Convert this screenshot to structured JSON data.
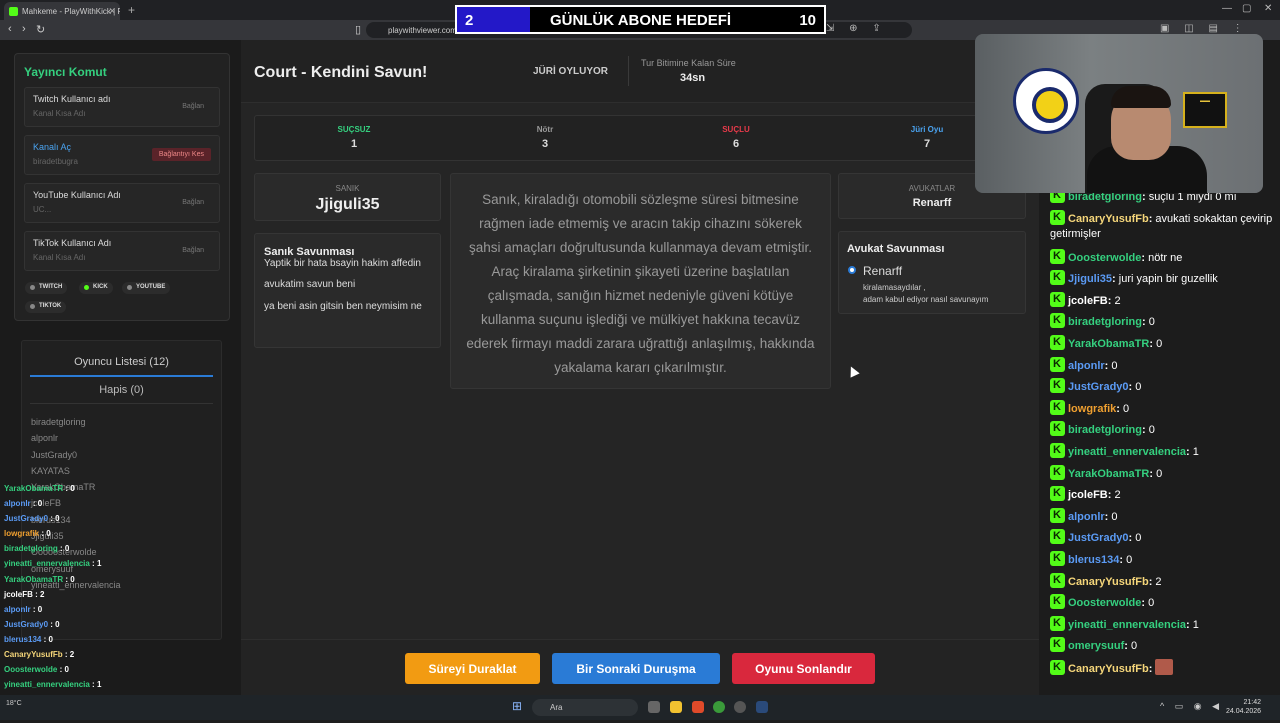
{
  "browser": {
    "tab_title": "Mahkeme - PlayWithKick | PlayW...",
    "url": "playwithviewer.com/..."
  },
  "goal": {
    "current": "2",
    "title": "GÜNLÜK ABONE HEDEFİ",
    "max": "10",
    "progress": 0.2
  },
  "left": {
    "panel_title": "Yayıncı Komut",
    "accounts": [
      {
        "name": "Twitch Kullanıcı adı",
        "sub": "Kanal Kısa Adı",
        "btn": "Bağlan"
      },
      {
        "name": "Kanalı Aç",
        "sub": "biradetbugra",
        "btn": "Bağlantıyı Kes"
      },
      {
        "name": "YouTube Kullanıcı Adı",
        "sub": "UC...",
        "btn": "Bağlan"
      },
      {
        "name": "TikTok Kullanıcı Adı",
        "sub": "Kanal Kısa Adı",
        "btn": "Bağlan"
      }
    ],
    "platforms": [
      "TWITCH",
      "KICK",
      "YOUTUBE",
      "TIKTOK"
    ],
    "players_title": "Oyuncu Listesi (12)",
    "jail_title": "Hapis (0)",
    "players": [
      "biradetgloring",
      "alponlr",
      "JustGrady0",
      "KAYATAS",
      "YarakObamaTR",
      "jcoleFB",
      "blerus134",
      "Jjiguli35",
      "Ooooosterwolde",
      "omerysuuf",
      "yineatti_ennervalencia"
    ]
  },
  "overlay_chat": [
    {
      "name": "YarakObamaTR",
      "val": "0",
      "color": "#35d07f"
    },
    {
      "name": "alponlr",
      "val": "0",
      "color": "#5b9bf5"
    },
    {
      "name": "JustGrady0",
      "val": "0",
      "color": "#5b9bf5"
    },
    {
      "name": "lowgrafik",
      "val": "0",
      "color": "#f0a030"
    },
    {
      "name": "biradetgloring",
      "val": "0",
      "color": "#35d07f"
    },
    {
      "name": "yineatti_ennervalencia",
      "val": "1",
      "color": "#35d07f"
    },
    {
      "name": "YarakObamaTR",
      "val": "0",
      "color": "#35d07f"
    },
    {
      "name": "jcoleFB",
      "val": "2",
      "color": "#fff"
    },
    {
      "name": "alponlr",
      "val": "0",
      "color": "#5b9bf5"
    },
    {
      "name": "JustGrady0",
      "val": "0",
      "color": "#5b9bf5"
    },
    {
      "name": "blerus134",
      "val": "0",
      "color": "#5b9bf5"
    },
    {
      "name": "CanaryYusufFb",
      "val": "2",
      "color": "#f5d67a"
    },
    {
      "name": "Ooosterwolde",
      "val": "0",
      "color": "#35d07f"
    },
    {
      "name": "yineatti_ennervalencia",
      "val": "1",
      "color": "#35d07f"
    },
    {
      "name": "omerysuuf",
      "val": "0",
      "color": "#35d07f"
    },
    {
      "name": "CanaryYusufFb",
      "val": "",
      "color": "#f5d67a"
    }
  ],
  "main": {
    "title": "Court - Kendini Savun!",
    "phase": "JÜRİ OYLUYOR",
    "timer_label": "Tur Bitimine Kalan Süre",
    "timer_value": "34sn",
    "stats": [
      {
        "label": "SUÇSUZ",
        "value": "1",
        "color": "#35d07f"
      },
      {
        "label": "Nötr",
        "value": "3",
        "color": "#999999"
      },
      {
        "label": "SUÇLU",
        "value": "6",
        "color": "#e83a4a"
      },
      {
        "label": "Jüri Oyu",
        "value": "7",
        "color": "#4aa3f0"
      }
    ],
    "defendant_label": "SANIK",
    "defendant_name": "Jjiguli35",
    "defense_title": "Sanık Savunması",
    "defense_lines": [
      "Yaptik bir hata bsayin hakim affedin",
      "avukatim savun beni",
      "ya beni asin gitsin ben neymisim ne"
    ],
    "case_text": "Sanık, kiraladığı otomobili sözleşme süresi bitmesine rağmen iade etmemiş ve aracın takip cihazını sökerek şahsi amaçları doğrultusunda kullanmaya devam etmiştir. Araç kiralama şirketinin şikayeti üzerine başlatılan çalışmada, sanığın hizmet nedeniyle güveni kötüye kullanma suçunu işlediği ve mülkiyet hakkına tecavüz ederek firmayı maddi zarara uğrattığı anlaşılmış, hakkında yakalama kararı çıkarılmıştır.",
    "lawyers_label": "AVUKATLAR",
    "lawyer_name": "Renarff",
    "lawyer_def_title": "Avukat Savunması",
    "lawyer_def_name": "Renarff",
    "lawyer_def_lines": [
      "kiralamasaydılar ,",
      "adam kabul ediyor nasıl savunayım"
    ],
    "buttons": {
      "pause": "Süreyi Duraklat",
      "next": "Bir Sonraki Duruşma",
      "end": "Oyunu Sonlandır"
    }
  },
  "chat": [
    {
      "name": "biradetgloring",
      "text": "suçlu 1 miydi 0 mı",
      "color": "#35d07f"
    },
    {
      "name": "CanaryYusufFb",
      "text": "avukati sokaktan çevirip getirmişler",
      "color": "#f5d67a"
    },
    {
      "name": "Ooosterwolde",
      "text": "nötr ne",
      "color": "#35d07f"
    },
    {
      "name": "Jjiguli35",
      "text": "juri yapin bir guzellik",
      "color": "#5b9bf5"
    },
    {
      "name": "jcoleFB",
      "text": "2",
      "color": "#ffffff"
    },
    {
      "name": "biradetgloring",
      "text": "0",
      "color": "#35d07f"
    },
    {
      "name": "YarakObamaTR",
      "text": "0",
      "color": "#35d07f"
    },
    {
      "name": "alponlr",
      "text": "0",
      "color": "#5b9bf5"
    },
    {
      "name": "JustGrady0",
      "text": "0",
      "color": "#5b9bf5"
    },
    {
      "name": "lowgrafik",
      "text": "0",
      "color": "#f0a030"
    },
    {
      "name": "biradetgloring",
      "text": "0",
      "color": "#35d07f"
    },
    {
      "name": "yineatti_ennervalencia",
      "text": "1",
      "color": "#35d07f"
    },
    {
      "name": "YarakObamaTR",
      "text": "0",
      "color": "#35d07f"
    },
    {
      "name": "jcoleFB",
      "text": "2",
      "color": "#ffffff"
    },
    {
      "name": "alponlr",
      "text": "0",
      "color": "#5b9bf5"
    },
    {
      "name": "JustGrady0",
      "text": "0",
      "color": "#5b9bf5"
    },
    {
      "name": "blerus134",
      "text": "0",
      "color": "#5b9bf5"
    },
    {
      "name": "CanaryYusufFb",
      "text": "2",
      "color": "#f5d67a"
    },
    {
      "name": "Ooosterwolde",
      "text": "0",
      "color": "#35d07f"
    },
    {
      "name": "yineatti_ennervalencia",
      "text": "1",
      "color": "#35d07f"
    },
    {
      "name": "omerysuuf",
      "text": "0",
      "color": "#35d07f"
    },
    {
      "name": "CanaryYusufFb",
      "text": "",
      "color": "#f5d67a"
    }
  ],
  "taskbar": {
    "weather": "18°C",
    "search": "Ara",
    "time": "21:42",
    "date": "24.04.2026"
  }
}
